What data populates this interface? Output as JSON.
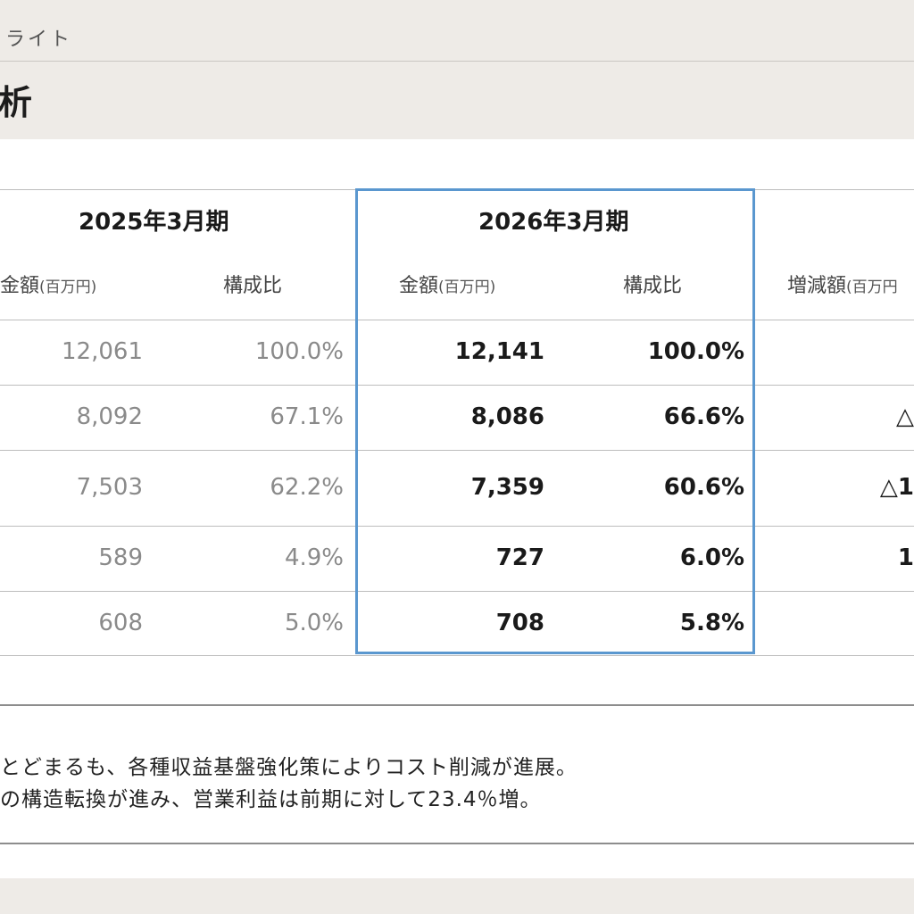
{
  "header": {
    "top_label": "ライト",
    "title": "析"
  },
  "table": {
    "periods": {
      "prev": "2025年3月期",
      "cur": "2026年3月期"
    },
    "subheaders": {
      "prev_amount": "金額",
      "prev_amount_unit": "(百万円)",
      "prev_ratio": "構成比",
      "cur_amount": "金額",
      "cur_amount_unit": "(百万円)",
      "cur_ratio": "構成比",
      "diff_amount": "増減額",
      "diff_amount_unit": "(百万円"
    },
    "rows": [
      {
        "prev_amount": "12,061",
        "prev_ratio": "100.0%",
        "cur_amount": "12,141",
        "cur_ratio": "100.0%",
        "diff": ""
      },
      {
        "prev_amount": "8,092",
        "prev_ratio": "67.1%",
        "cur_amount": "8,086",
        "cur_ratio": "66.6%",
        "diff": "△"
      },
      {
        "prev_amount": "7,503",
        "prev_ratio": "62.2%",
        "cur_amount": "7,359",
        "cur_ratio": "60.6%",
        "diff": "△1"
      },
      {
        "prev_amount": "589",
        "prev_ratio": "4.9%",
        "cur_amount": "727",
        "cur_ratio": "6.0%",
        "diff": "1"
      },
      {
        "prev_amount": "608",
        "prev_ratio": "5.0%",
        "cur_amount": "708",
        "cur_ratio": "5.8%",
        "diff": ""
      }
    ]
  },
  "notes": {
    "line1": "とどまるも、各種収益基盤強化策によりコスト削減が進展。",
    "line2": "の構造転換が進み、営業利益は前期に対して23.4％増。"
  },
  "colors": {
    "highlight_border": "#5a97cf",
    "background": "#eeebe7",
    "panel": "#ffffff"
  }
}
